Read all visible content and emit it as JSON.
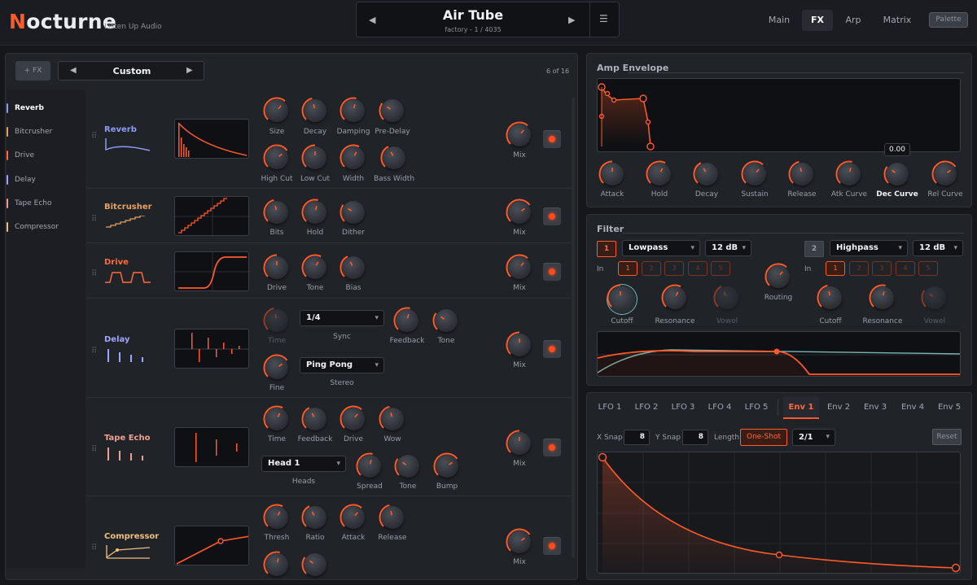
{
  "header": {
    "logo_first": "N",
    "logo_rest": "octurne",
    "brand": "Listen Up Audio",
    "preset_name": "Air Tube",
    "preset_sub": "factory - 1 / 4035",
    "prev": "◀",
    "next": "▶",
    "menu": "☰",
    "tabs": [
      {
        "label": "Main"
      },
      {
        "label": "FX"
      },
      {
        "label": "Arp"
      },
      {
        "label": "Matrix"
      }
    ],
    "palette": "Palette"
  },
  "fx": {
    "add_label": "+ FX",
    "chain_name": "Custom",
    "chain_prev": "◀",
    "chain_next": "▶",
    "count": "6 of 16",
    "sidebar": [
      {
        "label": "Reverb",
        "color": "#8d9cf0"
      },
      {
        "label": "Bitcrusher",
        "color": "#e8a060"
      },
      {
        "label": "Drive",
        "color": "#ff6a3a"
      },
      {
        "label": "Delay",
        "color": "#a0a4ff"
      },
      {
        "label": "Tape Echo",
        "color": "#f0a090"
      },
      {
        "label": "Compressor",
        "color": "#f0c080"
      }
    ],
    "reverb": {
      "name": "Reverb",
      "k": [
        "Size",
        "Decay",
        "Damping",
        "Pre-Delay",
        "High Cut",
        "Low Cut",
        "Width",
        "Bass Width"
      ],
      "mix": "Mix"
    },
    "bitcrusher": {
      "name": "Bitcrusher",
      "k": [
        "Bits",
        "Hold",
        "Dither"
      ],
      "mix": "Mix"
    },
    "drive": {
      "name": "Drive",
      "k": [
        "Drive",
        "Tone",
        "Bias"
      ],
      "mix": "Mix"
    },
    "delay": {
      "name": "Delay",
      "time": "Time",
      "sync_value": "1/4",
      "sync": "Sync",
      "feedback": "Feedback",
      "tone": "Tone",
      "fine": "Fine",
      "stereo_value": "Ping Pong",
      "stereo": "Stereo",
      "mix": "Mix"
    },
    "tape": {
      "name": "Tape Echo",
      "k": [
        "Time",
        "Feedback",
        "Drive",
        "Wow"
      ],
      "heads_value": "Head 1",
      "heads": "Heads",
      "spread": "Spread",
      "tone": "Tone",
      "bump": "Bump",
      "mix": "Mix"
    },
    "comp": {
      "name": "Compressor",
      "k": [
        "Thresh",
        "Ratio",
        "Attack",
        "Release"
      ],
      "mix": "Mix"
    }
  },
  "amp": {
    "title": "Amp Envelope",
    "readout": "0.00",
    "k": [
      "Attack",
      "Hold",
      "Decay",
      "Sustain",
      "Release",
      "Atk Curve",
      "Dec Curve",
      "Rel Curve"
    ]
  },
  "filter": {
    "title": "Filter",
    "f1": {
      "num": "1",
      "type": "Lowpass",
      "slope": "12 dB"
    },
    "f2": {
      "num": "2",
      "type": "Highpass",
      "slope": "12 dB"
    },
    "in": "In",
    "slots": [
      "1",
      "2",
      "3",
      "4",
      "5"
    ],
    "cutoff": "Cutoff",
    "resonance": "Resonance",
    "vowel": "Vowel",
    "routing": "Routing"
  },
  "mod": {
    "tabs": [
      "LFO 1",
      "LFO 2",
      "LFO 3",
      "LFO 4",
      "LFO 5",
      "Env 1",
      "Env 2",
      "Env 3",
      "Env 4",
      "Env 5"
    ],
    "xsnap": "X Snap",
    "xsnap_val": "8",
    "ysnap": "Y Snap",
    "ysnap_val": "8",
    "length": "Length",
    "oneshot": "One-Shot",
    "ratio": "2/1",
    "reset": "Reset"
  }
}
